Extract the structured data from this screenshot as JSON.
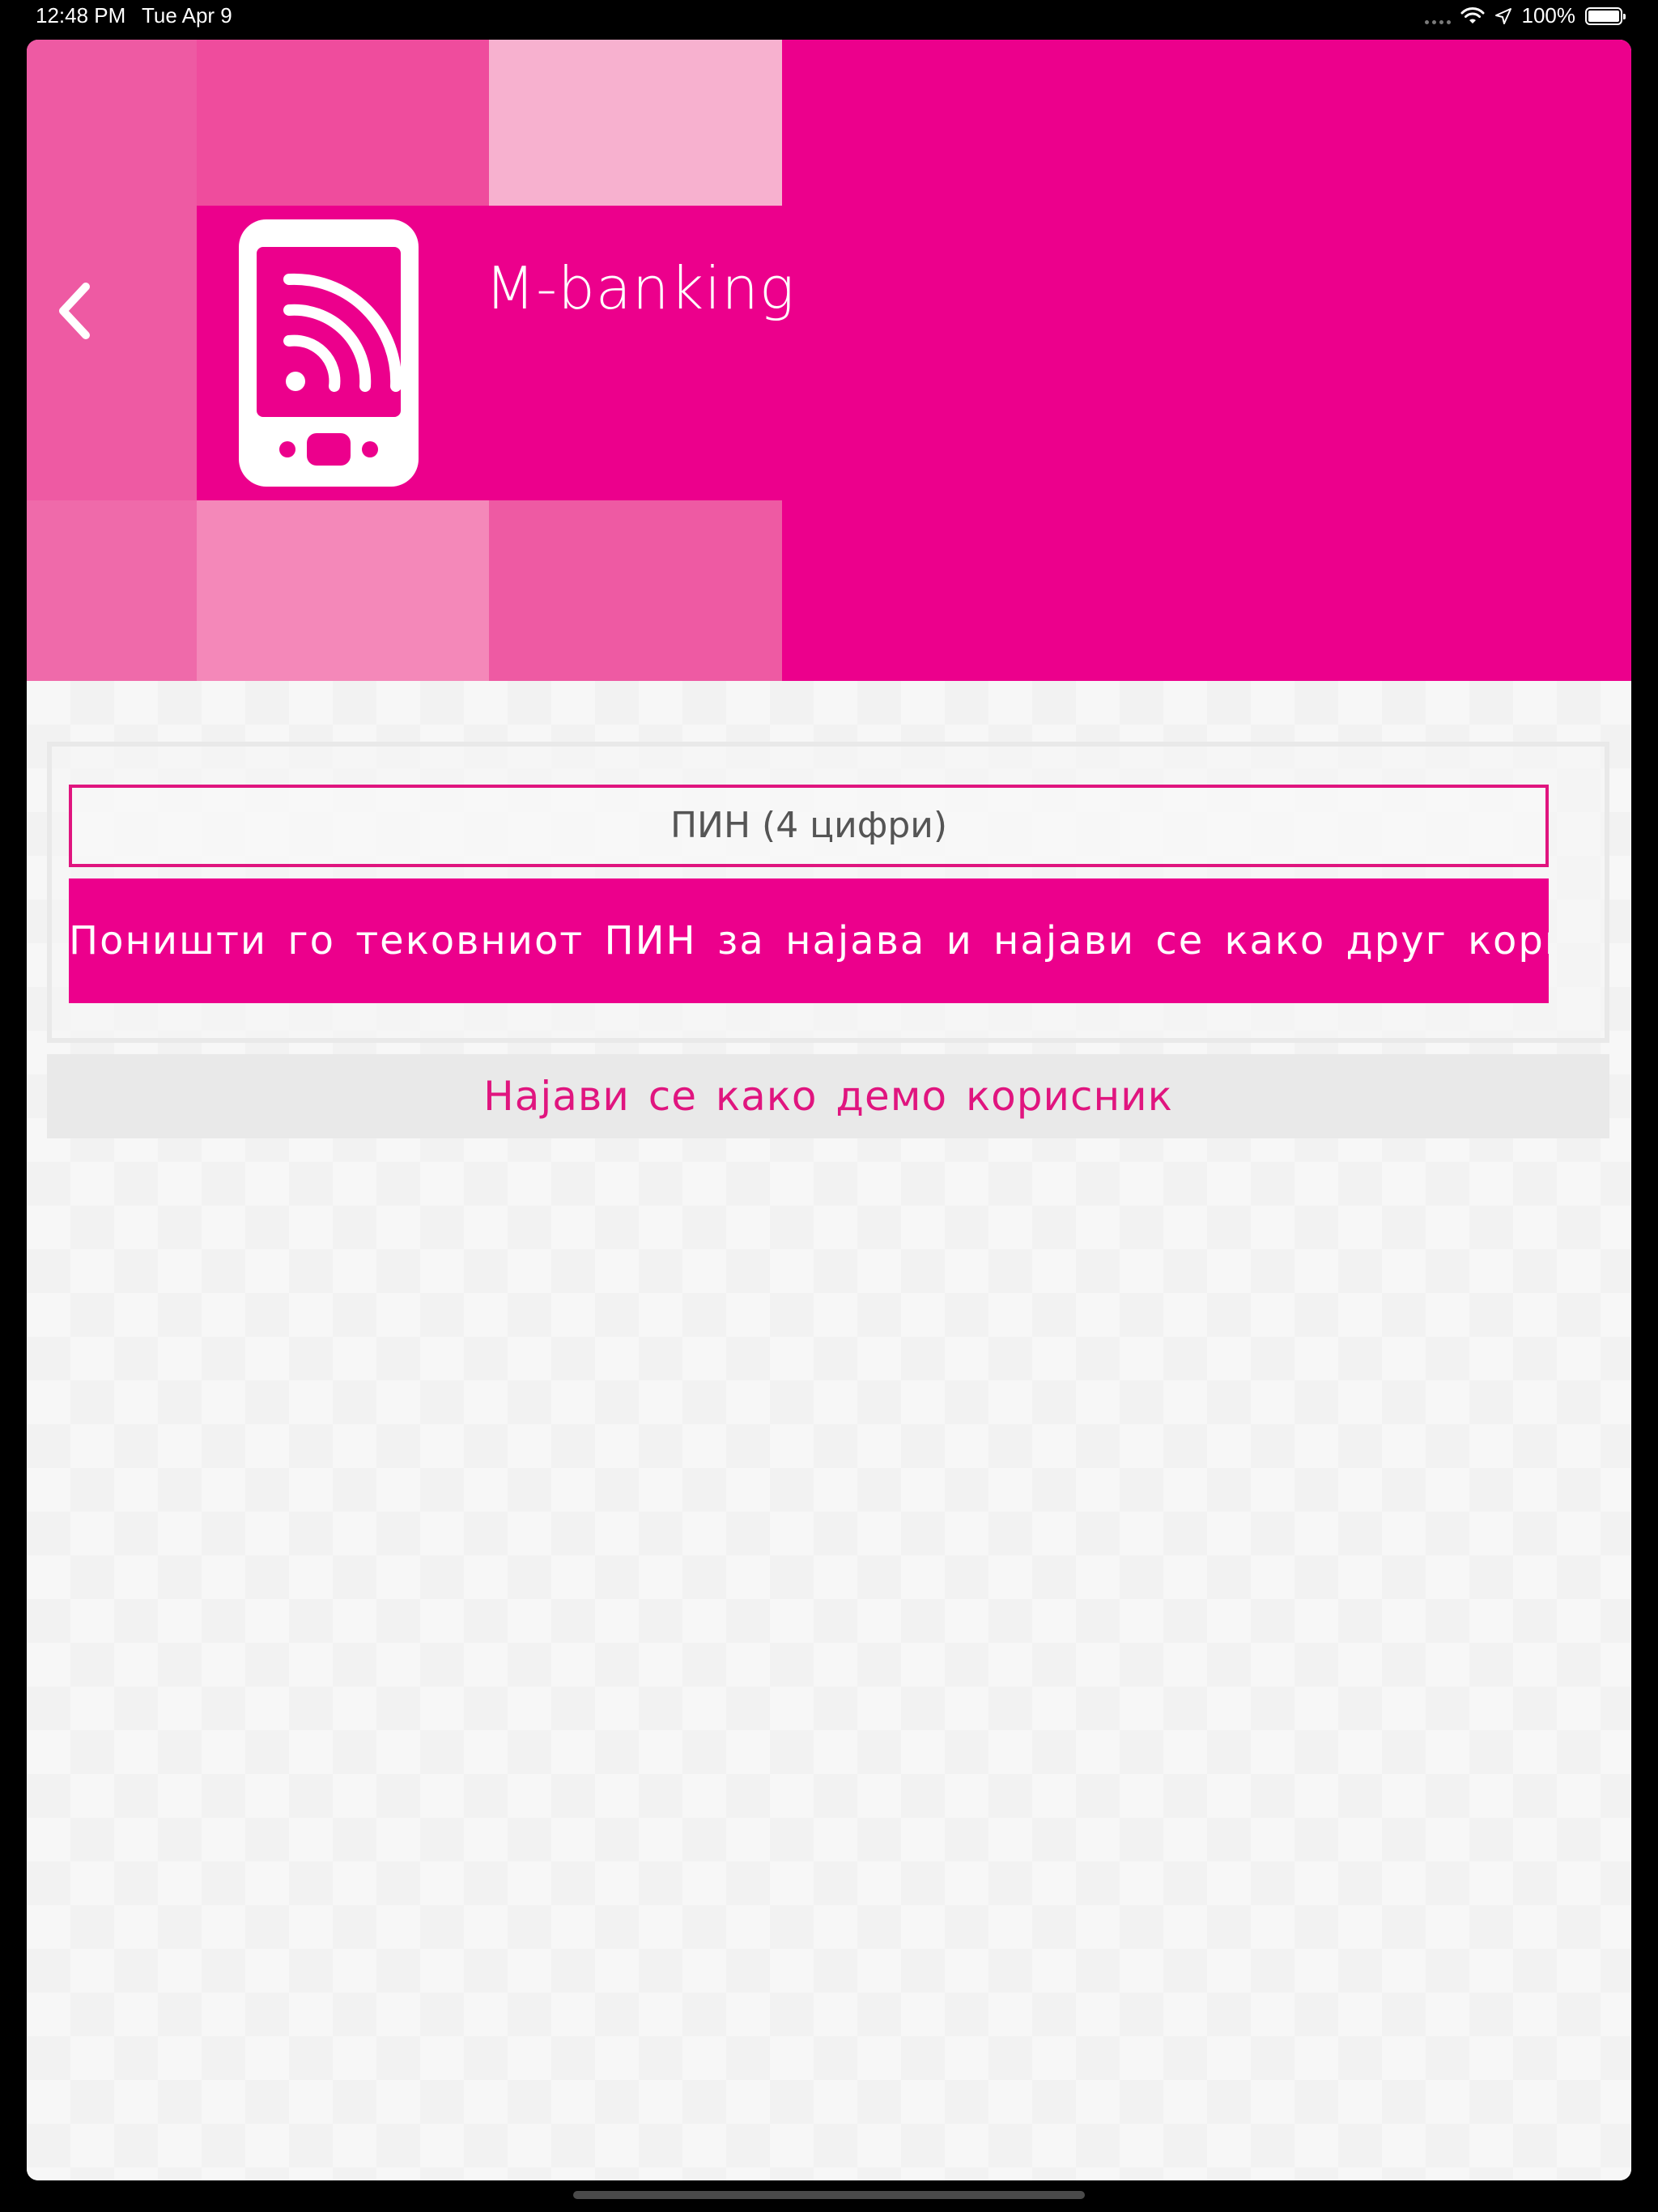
{
  "status_bar": {
    "time": "12:48 PM",
    "date": "Tue Apr 9",
    "battery": "100%",
    "icons": [
      "cellular-dots-icon",
      "wifi-icon",
      "location-arrow-icon",
      "battery-icon"
    ]
  },
  "header": {
    "title": "M-banking",
    "back_icon": "chevron-left-icon",
    "app_icon": "mobile-phone-rss-icon",
    "background_color": "#ec008c"
  },
  "login": {
    "pin_placeholder": "ПИН (4 цифри)",
    "reset_button_label": "Поништи го тековниот ПИН за најава и најави се како друг корисник",
    "demo_button_label": "Најави се како демо корисник"
  },
  "colors": {
    "accent": "#ec008c",
    "pin_border": "#e0157f",
    "demo_text": "#e0157f",
    "demo_background": "#e9e9e9"
  }
}
